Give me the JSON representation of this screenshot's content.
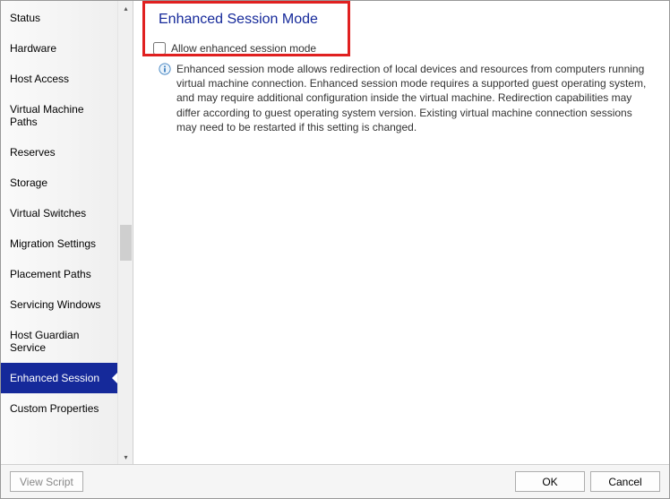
{
  "sidebar": {
    "items": [
      {
        "label": "Status"
      },
      {
        "label": "Hardware"
      },
      {
        "label": "Host Access"
      },
      {
        "label": "Virtual Machine Paths"
      },
      {
        "label": "Reserves"
      },
      {
        "label": "Storage"
      },
      {
        "label": "Virtual Switches"
      },
      {
        "label": "Migration Settings"
      },
      {
        "label": "Placement Paths"
      },
      {
        "label": "Servicing Windows"
      },
      {
        "label": "Host Guardian Service"
      },
      {
        "label": "Enhanced Session",
        "selected": true
      },
      {
        "label": "Custom Properties"
      }
    ]
  },
  "main": {
    "title": "Enhanced Session Mode",
    "checkbox_label": "Allow enhanced session mode",
    "checkbox_checked": false,
    "description": "Enhanced session mode allows redirection of local devices and resources from computers running virtual machine connection. Enhanced session mode requires a supported guest operating system, and may require additional configuration inside the virtual machine. Redirection capabilities may differ according to guest operating system version. Existing virtual machine connection sessions may need to be restarted if this setting is changed."
  },
  "footer": {
    "view_script": "View Script",
    "ok": "OK",
    "cancel": "Cancel"
  },
  "colors": {
    "accent": "#15299a",
    "highlight": "#e02020"
  }
}
